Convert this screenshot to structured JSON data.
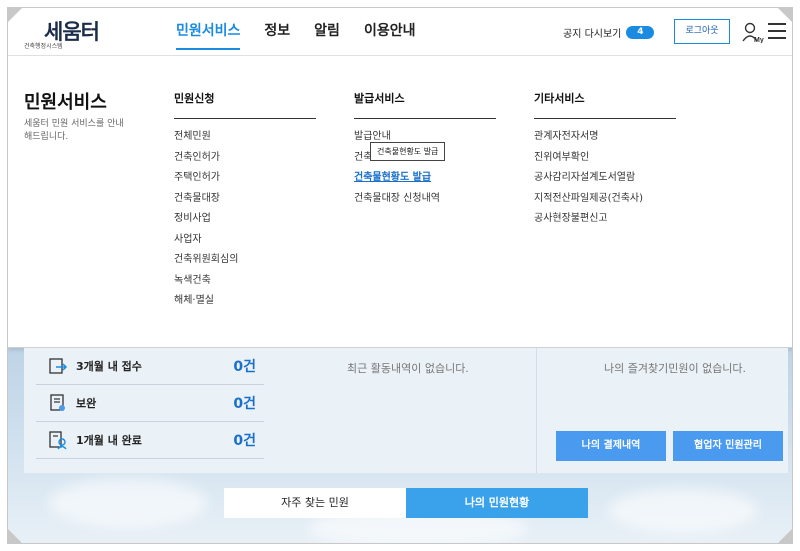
{
  "logo": {
    "main": "세움터",
    "sub": "건축행정시스템"
  },
  "nav": [
    {
      "label": "민원서비스",
      "active": true
    },
    {
      "label": "정보",
      "active": false
    },
    {
      "label": "알림",
      "active": false
    },
    {
      "label": "이용안내",
      "active": false
    }
  ],
  "header": {
    "notice_label": "공지 다시보기",
    "notice_count": "4",
    "logout_label": "로그아웃",
    "my_label": "My"
  },
  "mega": {
    "title": "민원서비스",
    "desc": "세움터 민원 서비스를 안내해드립니다.",
    "columns": [
      {
        "head": "민원신청",
        "items": [
          "전체민원",
          "건축인허가",
          "주택인허가",
          "건축물대장",
          "정비사업",
          "사업자",
          "건축위원회심의",
          "녹색건축",
          "해체·멸실"
        ]
      },
      {
        "head": "발급서비스",
        "items": [
          "발급안내",
          "건축",
          "건축물현황도 발급",
          "건축물대장 신청내역"
        ]
      },
      {
        "head": "기타서비스",
        "items": [
          "관계자전자서명",
          "진위여부확인",
          "공사감리자설계도서열람",
          "지적전산파일제공(건축사)",
          "공사현장불편신고"
        ]
      }
    ],
    "tooltip": "건축물현황도 발급"
  },
  "status": [
    {
      "label": "3개월 내 접수",
      "count": "0건"
    },
    {
      "label": "보완",
      "count": "0건"
    },
    {
      "label": "1개월 내 완료",
      "count": "0건"
    }
  ],
  "recent_empty": "최근 활동내역이 없습니다.",
  "fav_empty": "나의 즐겨찾기민원이 없습니다.",
  "buttons": {
    "payment": "나의 결제내역",
    "partner": "협업자 민원관리"
  },
  "tabs": {
    "faq": "자주 찾는 민원",
    "mine": "나의 민원현황"
  },
  "colors": {
    "accent": "#1a8be0",
    "button": "#4a9af0",
    "tab_active": "#3aa2ea"
  }
}
